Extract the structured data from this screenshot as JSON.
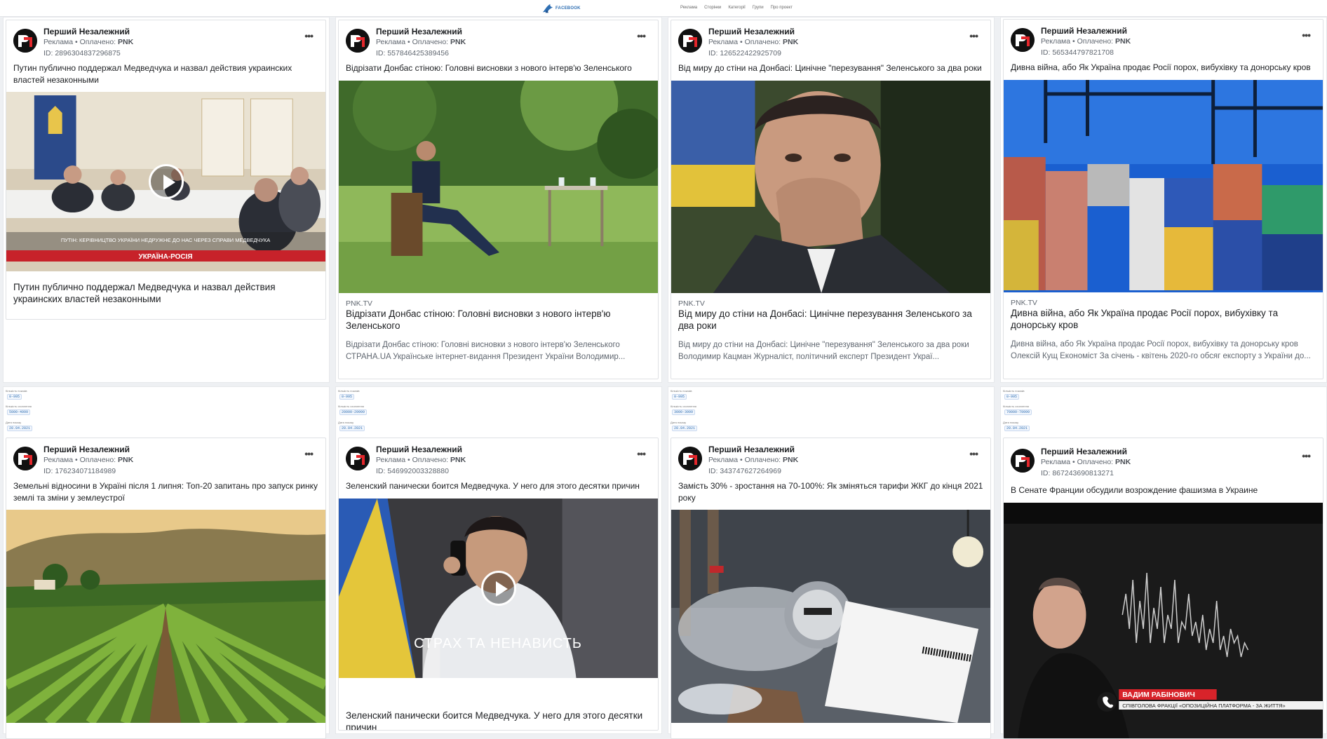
{
  "topbar": {
    "logo_text": "FACEBOOK",
    "nav": [
      "Реклама",
      "Сторінки",
      "Категорії",
      "Групи",
      "Про проект"
    ]
  },
  "ads": [
    {
      "page_name": "Перший Незалежний",
      "sponsored": "Реклама",
      "paid_label": "Оплачено:",
      "payer": "PNK",
      "ad_id": "ID: 2896304837296875",
      "body": "Путин публично поддержал Медведчука и назвал действия украинских властей незаконными",
      "media_type": "video",
      "media_caption_1": "ПУТІН: КЕРІВНИЦТВО УКРАЇНИ НЕДРУЖНЄ ДО НАС ЧЕРЕЗ СПРАВИ МЕДВЕДЧУКА",
      "media_caption_2": "УКРАЇНА-РОСІЯ",
      "title": "Путин публично поддержал Медведчука и назвал действия украинских властей незаконными"
    },
    {
      "page_name": "Перший Незалежний",
      "sponsored": "Реклама",
      "paid_label": "Оплачено:",
      "payer": "PNK",
      "ad_id": "ID: 557846425389456",
      "body": "Відрізати Донбас стіною: Головні висновки з нового інтерв'ю Зеленського",
      "media_type": "image",
      "domain": "PNK.TV",
      "title": "Відрізати Донбас стіною: Головні висновки з нового інтерв'ю Зеленського",
      "description": "Відрізати Донбас стіною: Головні висновки з нового інтерв'ю Зеленського СТРАНА.UA Українське інтернет-видання Президент України Володимир..."
    },
    {
      "page_name": "Перший Незалежний",
      "sponsored": "Реклама",
      "paid_label": "Оплачено:",
      "payer": "PNK",
      "ad_id": "ID: 126522422925709",
      "body": "Від миру до стіни на Донбасі: Цинічне \"перезування\" Зеленського за два роки",
      "media_type": "image",
      "domain": "PNK.TV",
      "title": "Від миру до стіни на Донбасі: Цинічне перезування Зеленського за два роки",
      "description": "Від миру до стіни на Донбасі: Цинічне \"перезування\" Зеленського за два роки Володимир Кацман Журналіст, політичний експерт Президент Украї..."
    },
    {
      "page_name": "Перший Незалежний",
      "sponsored": "Реклама",
      "paid_label": "Оплачено:",
      "payer": "PNK",
      "ad_id": "ID: 565344797821708",
      "body": "Дивна війна, або Як Україна продає Росії порох, вибухівку та донорську кров",
      "media_type": "image",
      "domain": "PNK.TV",
      "title": "Дивна війна, або Як Україна продає Росії порох, вибухівку та донорську кров",
      "description": "Дивна війна, або Як Україна продає Росії порох, вибухівку та донорську кров Олексій Кущ Економіст За січень - квітень 2020-го обсяг експорту з України до..."
    },
    {
      "page_name": "Перший Незалежний",
      "sponsored": "Реклама",
      "paid_label": "Оплачено:",
      "payer": "PNK",
      "ad_id": "ID: 176234071184989",
      "body": "Земельні відносини в Україні після 1 липня: Топ-20 запитань про запуск ринку землі та зміни у землеустрої",
      "media_type": "image",
      "meta": {
        "impressions": "0-995",
        "reach": "5000-4999",
        "date": "20.04.2021"
      }
    },
    {
      "page_name": "Перший Незалежний",
      "sponsored": "Реклама",
      "paid_label": "Оплачено:",
      "payer": "PNK",
      "ad_id": "ID: 546992003328880",
      "body": "Зеленский панически боится Медведчука. У него для этого десятки причин",
      "media_type": "video",
      "media_caption_1": "СТРАХ ТА НЕНАВИСТЬ",
      "title": "Зеленский панически боится Медведчука. У него для этого десятки причин",
      "meta": {
        "impressions": "0-995",
        "reach": "20000-29999",
        "date": "20.04.2021"
      }
    },
    {
      "page_name": "Перший Незалежний",
      "sponsored": "Реклама",
      "paid_label": "Оплачено:",
      "payer": "PNK",
      "ad_id": "ID: 343747627264969",
      "body": "Замість 30% - зростання на 70-100%: Як зміняться тарифи ЖКГ до кінця 2021 року",
      "media_type": "image",
      "meta": {
        "impressions": "0-995",
        "reach": "3000-3999",
        "date": "20.04.2021"
      }
    },
    {
      "page_name": "Перший Незалежний",
      "sponsored": "Реклама",
      "paid_label": "Оплачено:",
      "payer": "PNK",
      "ad_id": "ID: 867243690813271",
      "body": "В Сенате Франции обсудили возрождение фашизма в Украине",
      "media_type": "video",
      "media_caption_1": "ВАДИМ РАБІНОВИЧ",
      "media_caption_2": "СПІВГОЛОВА ФРАКЦІЇ «ОПОЗИЦІЙНА ПЛАТФОРМА - ЗА ЖИТТЯ»",
      "meta": {
        "impressions": "0-995",
        "reach": "70000-79999",
        "date": "20.04.2021"
      }
    }
  ],
  "meta_labels": {
    "impressions": "Кількість показів",
    "reach": "Кількість охоплення",
    "date": "Дата показу"
  },
  "colors": {
    "link_blue": "#2f6fb3",
    "text": "#1c1e21",
    "muted": "#606770"
  }
}
